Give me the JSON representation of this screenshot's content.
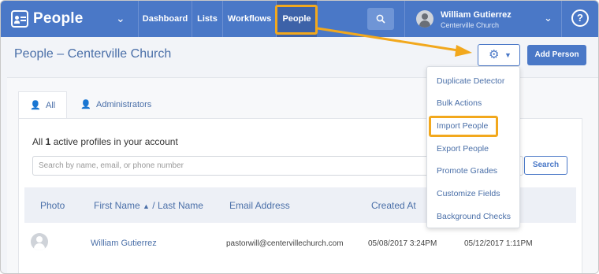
{
  "app": {
    "name": "People"
  },
  "nav": {
    "items": [
      {
        "label": "Dashboard"
      },
      {
        "label": "Lists"
      },
      {
        "label": "Workflows"
      },
      {
        "label": "People"
      }
    ]
  },
  "user": {
    "name": "William Gutierrez",
    "church": "Centerville Church"
  },
  "help": {
    "label": "?"
  },
  "page": {
    "title": "People – Centerville Church",
    "add_person_label": "Add Person"
  },
  "tabs": [
    {
      "label": "All"
    },
    {
      "label": "Administrators"
    }
  ],
  "summary": {
    "prefix": "All ",
    "count": "1",
    "suffix": " active profiles in your account"
  },
  "search": {
    "placeholder": "Search by name, email, or phone number",
    "button_label": "Search"
  },
  "table": {
    "columns": {
      "photo": "Photo",
      "first_name": "First Name",
      "sep": "/ Last Name",
      "email": "Email Address",
      "created": "Created At"
    },
    "rows": [
      {
        "name": "William Gutierrez",
        "email": "pastorwill@centervillechurch.com",
        "created": "05/08/2017 3:24PM",
        "updated": "05/12/2017 1:11PM"
      }
    ]
  },
  "dropdown": {
    "items": [
      {
        "label": "Duplicate Detector"
      },
      {
        "label": "Bulk Actions"
      },
      {
        "label": "Import People"
      },
      {
        "label": "Export People"
      },
      {
        "label": "Promote Grades"
      },
      {
        "label": "Customize Fields"
      },
      {
        "label": "Background Checks"
      }
    ]
  },
  "colors": {
    "brand": "#4a78c7",
    "nav_active": "#3d62a8",
    "highlight": "#f2a81d",
    "link": "#4a6fa8"
  },
  "icons": {
    "logo": "people-logo-icon",
    "search": "search-icon",
    "gear": "gear-icon",
    "help": "help-icon",
    "user_tab": "person-icon",
    "admin_tab": "admin-person-icon",
    "sort": "sort-up-icon"
  }
}
